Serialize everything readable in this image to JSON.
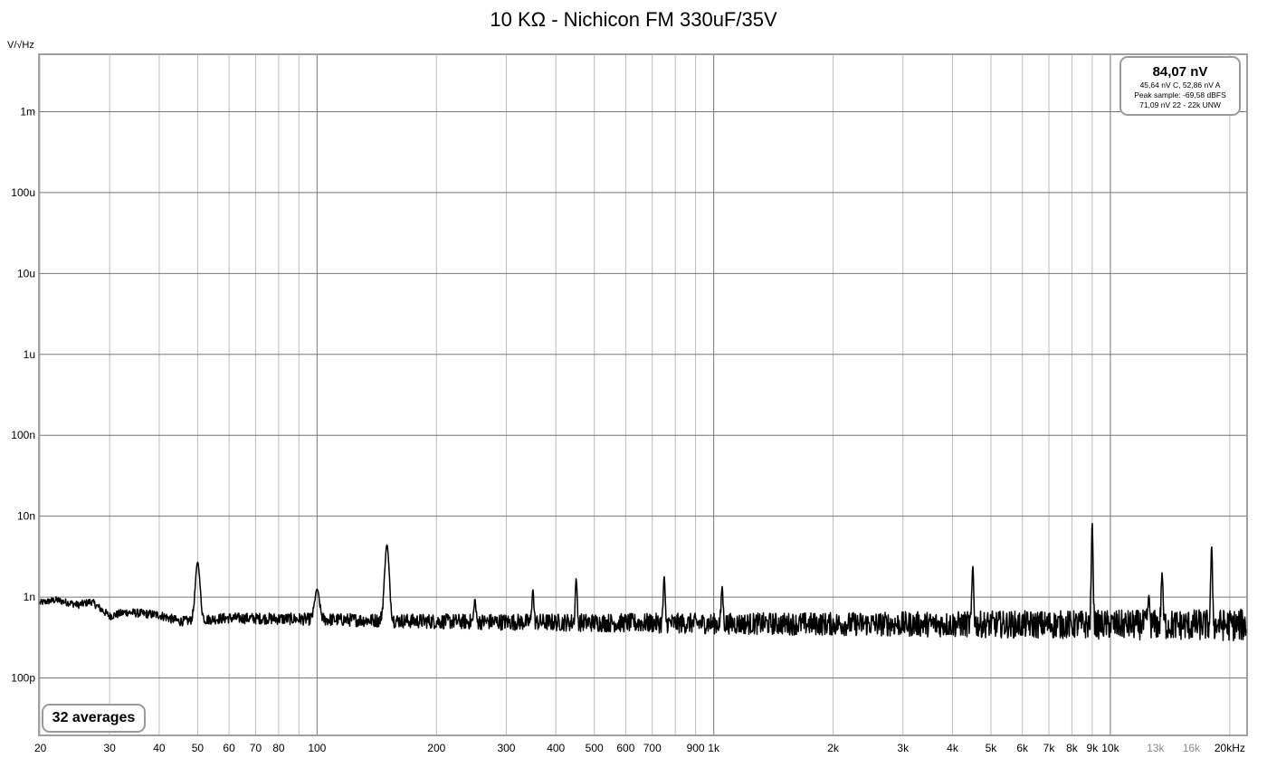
{
  "chart_data": {
    "type": "line",
    "title": "10 KΩ - Nichicon FM 330uF/35V",
    "ylabel": "V/√Hz",
    "xlabel": "",
    "x_scale": "log",
    "y_scale": "log",
    "xlim": [
      20,
      22000
    ],
    "ylim": [
      2e-11,
      0.005
    ],
    "grid": true,
    "y_ticks": [
      {
        "value": 0.001,
        "label": "1m"
      },
      {
        "value": 0.0001,
        "label": "100u"
      },
      {
        "value": 1e-05,
        "label": "10u"
      },
      {
        "value": 1e-06,
        "label": "1u"
      },
      {
        "value": 1e-07,
        "label": "100n"
      },
      {
        "value": 1e-08,
        "label": "10n"
      },
      {
        "value": 1e-09,
        "label": "1n"
      },
      {
        "value": 1e-10,
        "label": "100p"
      }
    ],
    "x_ticks": [
      {
        "value": 20,
        "label": "20"
      },
      {
        "value": 30,
        "label": "30"
      },
      {
        "value": 40,
        "label": "40"
      },
      {
        "value": 50,
        "label": "50"
      },
      {
        "value": 60,
        "label": "60"
      },
      {
        "value": 70,
        "label": "70"
      },
      {
        "value": 80,
        "label": "80"
      },
      {
        "value": 100,
        "label": "100"
      },
      {
        "value": 200,
        "label": "200"
      },
      {
        "value": 300,
        "label": "300"
      },
      {
        "value": 400,
        "label": "400"
      },
      {
        "value": 500,
        "label": "500"
      },
      {
        "value": 600,
        "label": "600"
      },
      {
        "value": 700,
        "label": "700"
      },
      {
        "value": 900,
        "label": "900"
      },
      {
        "value": 1000,
        "label": "1k"
      },
      {
        "value": 2000,
        "label": "2k"
      },
      {
        "value": 3000,
        "label": "3k"
      },
      {
        "value": 4000,
        "label": "4k"
      },
      {
        "value": 5000,
        "label": "5k"
      },
      {
        "value": 6000,
        "label": "6k"
      },
      {
        "value": 7000,
        "label": "7k"
      },
      {
        "value": 8000,
        "label": "8k"
      },
      {
        "value": 9000,
        "label": "9k"
      },
      {
        "value": 10000,
        "label": "10k"
      },
      {
        "value": 13000,
        "label": "13k",
        "muted": true
      },
      {
        "value": 16000,
        "label": "16k",
        "muted": true
      },
      {
        "value": 20000,
        "label": "20kHz"
      }
    ],
    "series": [
      {
        "color": "#000000",
        "floor_points": [
          {
            "x": 20,
            "y": 8.5e-10
          },
          {
            "x": 22,
            "y": 9.2e-10
          },
          {
            "x": 25,
            "y": 8e-10
          },
          {
            "x": 27,
            "y": 8.8e-10
          },
          {
            "x": 30,
            "y": 5.8e-10
          },
          {
            "x": 33,
            "y": 6.5e-10
          },
          {
            "x": 40,
            "y": 6e-10
          },
          {
            "x": 45,
            "y": 5e-10
          },
          {
            "x": 60,
            "y": 5.5e-10
          },
          {
            "x": 100,
            "y": 5.3e-10
          },
          {
            "x": 200,
            "y": 5e-10
          },
          {
            "x": 1000,
            "y": 4.7e-10
          },
          {
            "x": 22000,
            "y": 4.5e-10
          }
        ],
        "peaks": [
          {
            "x": 50,
            "y": 2.7e-09
          },
          {
            "x": 100,
            "y": 1.25e-09
          },
          {
            "x": 150,
            "y": 4.4e-09
          },
          {
            "x": 250,
            "y": 9.5e-10
          },
          {
            "x": 350,
            "y": 1.25e-09
          },
          {
            "x": 450,
            "y": 1.7e-09
          },
          {
            "x": 750,
            "y": 1.8e-09
          },
          {
            "x": 1050,
            "y": 1.35e-09
          },
          {
            "x": 4500,
            "y": 2.4e-09
          },
          {
            "x": 9000,
            "y": 8.3e-09
          },
          {
            "x": 12500,
            "y": 1.05e-09
          },
          {
            "x": 13500,
            "y": 2e-09
          },
          {
            "x": 18000,
            "y": 4.3e-09
          }
        ]
      }
    ]
  },
  "stats": {
    "main": "84,07 nV",
    "line1": "45,64 nV C, 52,86 nV A",
    "line2": "Peak sample: -69,58 dBFS",
    "line3": "71,09 nV 22 - 22k UNW"
  },
  "averages_label": "32 averages",
  "colors": {
    "grid_major": "#777777",
    "grid_minor": "#bdbdbd",
    "frame": "#a0a0a0",
    "box_border": "#9a9a9a"
  }
}
